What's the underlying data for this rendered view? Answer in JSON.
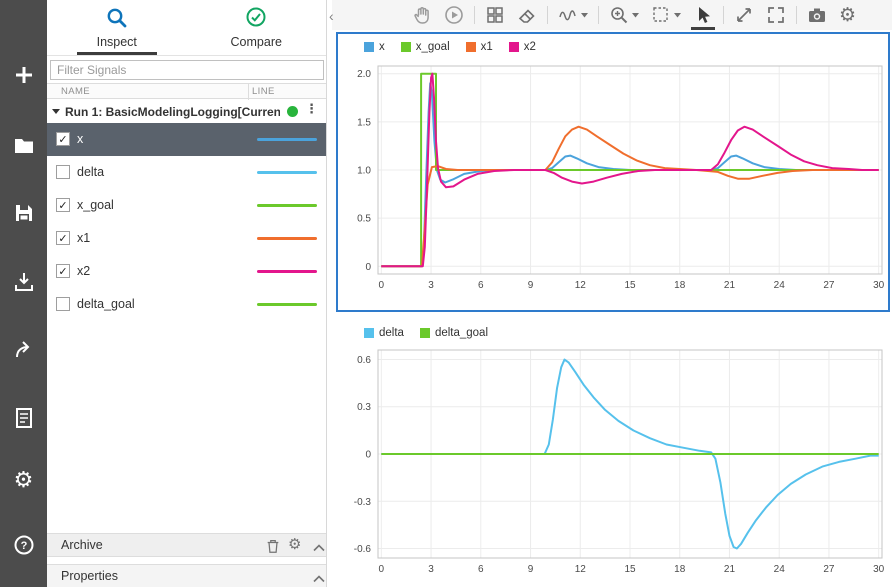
{
  "left_rail": {
    "buttons": [
      "add",
      "open",
      "save",
      "import",
      "export",
      "create-report",
      "preferences",
      "help"
    ]
  },
  "tabs": {
    "items": [
      {
        "label": "Inspect",
        "icon": "search-icon",
        "active": true
      },
      {
        "label": "Compare",
        "icon": "check-circle-icon",
        "active": false
      }
    ]
  },
  "filter": {
    "placeholder": "Filter Signals"
  },
  "signal_table": {
    "columns": [
      "NAME",
      "LINE"
    ],
    "run": {
      "label": "Run 1: BasicModelingLogging[Curren",
      "status_color": "#28b43c"
    },
    "rows": [
      {
        "name": "x",
        "checked": true,
        "selected": true,
        "color": "#4ba3dc"
      },
      {
        "name": "delta",
        "checked": false,
        "selected": false,
        "color": "#56c1ec"
      },
      {
        "name": "x_goal",
        "checked": true,
        "selected": false,
        "color": "#6bc92b"
      },
      {
        "name": "x1",
        "checked": true,
        "selected": false,
        "color": "#f06e2d"
      },
      {
        "name": "x2",
        "checked": true,
        "selected": false,
        "color": "#e3168c"
      },
      {
        "name": "delta_goal",
        "checked": false,
        "selected": false,
        "color": "#6bc92b"
      }
    ]
  },
  "archive": {
    "label": "Archive",
    "icons": [
      "trash-icon",
      "gear-icon",
      "collapse-up-icon"
    ]
  },
  "properties": {
    "label": "Properties",
    "icons": [
      "collapse-up-icon"
    ]
  },
  "toolbar": {
    "tools": [
      "pan",
      "run",
      "layout",
      "erase",
      "signal-style",
      "zoom-in",
      "zoom-region",
      "pointer",
      "expand",
      "fit-to-view",
      "snapshot",
      "settings"
    ],
    "active_tool": "pointer"
  },
  "colors": {
    "selection_border": "#2e7bcc",
    "selected_row_bg": "#5a626c",
    "rail_bg": "#4c4c4c",
    "toolbar_bg": "#f5f5f5",
    "grid_line": "#ececec",
    "plot_border": "#c5c5c5"
  },
  "chart_data": [
    {
      "type": "line",
      "title": "",
      "xlabel": "",
      "ylabel": "",
      "grid": true,
      "legend_position": "top-left",
      "selected": true,
      "xlim": [
        -0.2,
        30.2
      ],
      "ylim": [
        -0.08,
        2.08
      ],
      "xtick_values": [
        0,
        3,
        6,
        9,
        12,
        15,
        18,
        21,
        24,
        27,
        30
      ],
      "xtick_labels": [
        "0",
        "3",
        "6",
        "9",
        "12",
        "15",
        "18",
        "21",
        "24",
        "27",
        "30"
      ],
      "ytick_values": [
        0,
        0.5,
        1,
        1.5,
        2
      ],
      "ytick_labels": [
        "0",
        "0.5",
        "1.0",
        "1.5",
        "2.0"
      ],
      "series": [
        {
          "name": "x",
          "color": "#4ba3dc",
          "points": [
            [
              0,
              0
            ],
            [
              2.45,
              0
            ],
            [
              2.55,
              0.15
            ],
            [
              2.7,
              0.9
            ],
            [
              2.85,
              1.6
            ],
            [
              2.95,
              1.9
            ],
            [
              3.05,
              1.8
            ],
            [
              3.2,
              1.3
            ],
            [
              3.35,
              1.0
            ],
            [
              3.55,
              0.9
            ],
            [
              3.85,
              0.87
            ],
            [
              4.3,
              0.9
            ],
            [
              5,
              0.96
            ],
            [
              6,
              0.99
            ],
            [
              7,
              1
            ],
            [
              9.9,
              1
            ],
            [
              10.3,
              1.02
            ],
            [
              10.7,
              1.08
            ],
            [
              11.1,
              1.14
            ],
            [
              11.4,
              1.15
            ],
            [
              11.8,
              1.12
            ],
            [
              12.4,
              1.07
            ],
            [
              13.1,
              1.03
            ],
            [
              14,
              1.01
            ],
            [
              15,
              1
            ],
            [
              19.9,
              1
            ],
            [
              20.3,
              1.02
            ],
            [
              20.7,
              1.08
            ],
            [
              21.1,
              1.14
            ],
            [
              21.4,
              1.15
            ],
            [
              21.8,
              1.12
            ],
            [
              22.4,
              1.07
            ],
            [
              23.1,
              1.03
            ],
            [
              24,
              1.01
            ],
            [
              25,
              1
            ],
            [
              30,
              1
            ]
          ]
        },
        {
          "name": "x_goal",
          "color": "#6bc92b",
          "points": [
            [
              0,
              0
            ],
            [
              2.4,
              0
            ],
            [
              2.4,
              2
            ],
            [
              3.3,
              2
            ],
            [
              3.3,
              1
            ],
            [
              30,
              1
            ]
          ]
        },
        {
          "name": "x1",
          "color": "#f06e2d",
          "points": [
            [
              0,
              0
            ],
            [
              2.45,
              0
            ],
            [
              2.6,
              0.35
            ],
            [
              2.8,
              0.85
            ],
            [
              3.05,
              1.03
            ],
            [
              3.4,
              1.04
            ],
            [
              3.9,
              1.01
            ],
            [
              4.6,
              1
            ],
            [
              9.9,
              1
            ],
            [
              10.3,
              1.08
            ],
            [
              10.7,
              1.22
            ],
            [
              11.1,
              1.35
            ],
            [
              11.5,
              1.42
            ],
            [
              11.9,
              1.45
            ],
            [
              12.4,
              1.42
            ],
            [
              13,
              1.35
            ],
            [
              13.8,
              1.26
            ],
            [
              14.6,
              1.17
            ],
            [
              15.4,
              1.1
            ],
            [
              16.2,
              1.05
            ],
            [
              17.1,
              1.02
            ],
            [
              18,
              1.01
            ],
            [
              19,
              1
            ],
            [
              20.3,
              0.98
            ],
            [
              20.9,
              0.94
            ],
            [
              21.5,
              0.91
            ],
            [
              22.2,
              0.91
            ],
            [
              23,
              0.94
            ],
            [
              23.9,
              0.97
            ],
            [
              24.8,
              0.99
            ],
            [
              26,
              1
            ],
            [
              30,
              1
            ]
          ]
        },
        {
          "name": "x2",
          "color": "#e3168c",
          "points": [
            [
              0,
              0
            ],
            [
              2.5,
              0
            ],
            [
              2.62,
              0.2
            ],
            [
              2.75,
              0.8
            ],
            [
              2.9,
              1.6
            ],
            [
              3,
              1.96
            ],
            [
              3.08,
              2.0
            ],
            [
              3.18,
              1.75
            ],
            [
              3.3,
              1.3
            ],
            [
              3.42,
              1.02
            ],
            [
              3.6,
              0.88
            ],
            [
              3.9,
              0.82
            ],
            [
              4.35,
              0.83
            ],
            [
              5,
              0.9
            ],
            [
              5.8,
              0.96
            ],
            [
              6.8,
              0.99
            ],
            [
              8,
              1
            ],
            [
              9.9,
              1
            ],
            [
              10.4,
              0.97
            ],
            [
              10.9,
              0.92
            ],
            [
              11.5,
              0.88
            ],
            [
              12.1,
              0.86
            ],
            [
              12.8,
              0.88
            ],
            [
              13.6,
              0.92
            ],
            [
              14.5,
              0.96
            ],
            [
              15.5,
              0.99
            ],
            [
              16.5,
              1
            ],
            [
              19.9,
              1
            ],
            [
              20.3,
              1.06
            ],
            [
              20.7,
              1.18
            ],
            [
              21.1,
              1.31
            ],
            [
              21.5,
              1.41
            ],
            [
              21.9,
              1.45
            ],
            [
              22.4,
              1.42
            ],
            [
              23.1,
              1.34
            ],
            [
              23.9,
              1.25
            ],
            [
              24.7,
              1.16
            ],
            [
              25.5,
              1.09
            ],
            [
              26.3,
              1.05
            ],
            [
              27.2,
              1.02
            ],
            [
              28.2,
              1.01
            ],
            [
              29,
              1
            ],
            [
              30,
              1
            ]
          ]
        }
      ]
    },
    {
      "type": "line",
      "title": "",
      "xlabel": "",
      "ylabel": "",
      "grid": true,
      "legend_position": "top-left",
      "selected": false,
      "xlim": [
        -0.2,
        30.2
      ],
      "ylim": [
        -0.66,
        0.66
      ],
      "xtick_values": [
        0,
        3,
        6,
        9,
        12,
        15,
        18,
        21,
        24,
        27,
        30
      ],
      "xtick_labels": [
        "0",
        "3",
        "6",
        "9",
        "12",
        "15",
        "18",
        "21",
        "24",
        "27",
        "30"
      ],
      "ytick_values": [
        -0.6,
        -0.3,
        0,
        0.3,
        0.6
      ],
      "ytick_labels": [
        "-0.6",
        "-0.3",
        "0",
        "0.3",
        "0.6"
      ],
      "series": [
        {
          "name": "delta",
          "color": "#56c1ec",
          "points": [
            [
              0,
              0
            ],
            [
              9.85,
              0
            ],
            [
              10.1,
              0.06
            ],
            [
              10.35,
              0.22
            ],
            [
              10.6,
              0.42
            ],
            [
              10.85,
              0.55
            ],
            [
              11.05,
              0.6
            ],
            [
              11.3,
              0.58
            ],
            [
              11.7,
              0.52
            ],
            [
              12.2,
              0.44
            ],
            [
              12.8,
              0.36
            ],
            [
              13.5,
              0.28
            ],
            [
              14.3,
              0.21
            ],
            [
              15.2,
              0.15
            ],
            [
              16.2,
              0.1
            ],
            [
              17.2,
              0.06
            ],
            [
              18.2,
              0.04
            ],
            [
              19.2,
              0.02
            ],
            [
              19.9,
              0.01
            ],
            [
              20.15,
              -0.03
            ],
            [
              20.45,
              -0.18
            ],
            [
              20.75,
              -0.38
            ],
            [
              21,
              -0.52
            ],
            [
              21.25,
              -0.59
            ],
            [
              21.45,
              -0.6
            ],
            [
              21.7,
              -0.57
            ],
            [
              22.1,
              -0.5
            ],
            [
              22.6,
              -0.42
            ],
            [
              23.2,
              -0.34
            ],
            [
              23.9,
              -0.26
            ],
            [
              24.7,
              -0.19
            ],
            [
              25.6,
              -0.13
            ],
            [
              26.6,
              -0.08
            ],
            [
              27.6,
              -0.05
            ],
            [
              28.6,
              -0.03
            ],
            [
              29.5,
              -0.01
            ],
            [
              30,
              -0.01
            ]
          ]
        },
        {
          "name": "delta_goal",
          "color": "#6bc92b",
          "points": [
            [
              0,
              0
            ],
            [
              30,
              0
            ]
          ]
        }
      ]
    }
  ]
}
